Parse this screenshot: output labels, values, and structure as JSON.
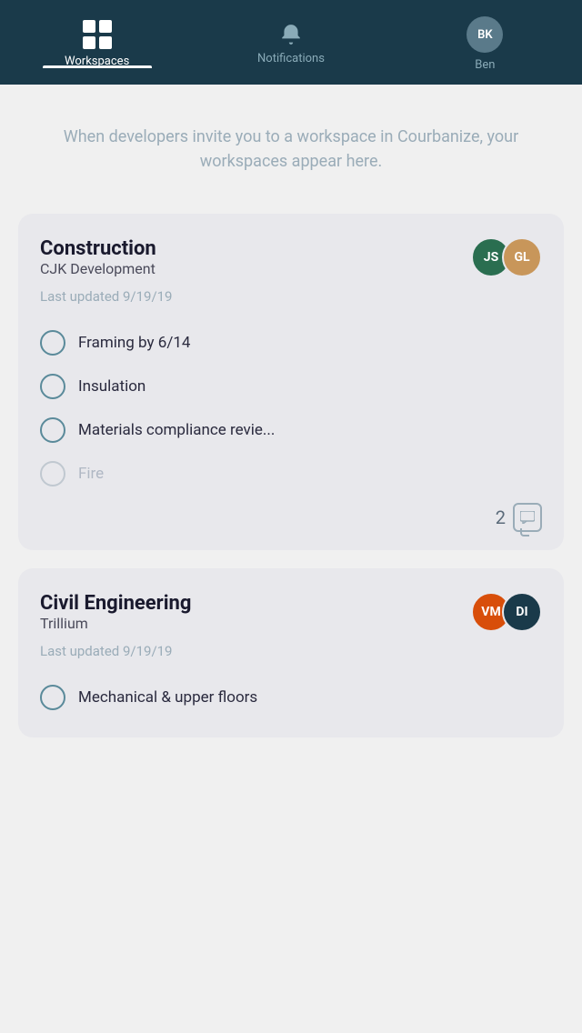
{
  "header": {
    "nav": [
      {
        "id": "workspaces",
        "label": "Workspaces",
        "active": true
      },
      {
        "id": "notifications",
        "label": "Notifications",
        "active": false
      },
      {
        "id": "profile",
        "label": "Ben",
        "initials": "BK",
        "active": false
      }
    ]
  },
  "info": {
    "text": "When developers invite you to a workspace in Courbanize, your workspaces appear here."
  },
  "cards": [
    {
      "id": "construction",
      "title": "Construction",
      "subtitle": "CJK Development",
      "last_updated": "Last updated 9/19/19",
      "avatars": [
        {
          "initials": "JS",
          "color": "#2a6e50"
        },
        {
          "initials": "GL",
          "color": "#c8965a"
        }
      ],
      "tasks": [
        {
          "label": "Framing by 6/14",
          "disabled": false
        },
        {
          "label": "Insulation",
          "disabled": false
        },
        {
          "label": "Materials compliance revie...",
          "disabled": false
        },
        {
          "label": "Fire",
          "disabled": true
        }
      ],
      "comment_count": "2"
    },
    {
      "id": "civil-engineering",
      "title": "Civil Engineering",
      "subtitle": "Trillium",
      "last_updated": "Last updated 9/19/19",
      "avatars": [
        {
          "initials": "VM",
          "color": "#d84e0a"
        },
        {
          "initials": "DI",
          "color": "#1a3a4a"
        }
      ],
      "tasks": [
        {
          "label": "Mechanical & upper floors",
          "disabled": false
        }
      ],
      "comment_count": ""
    }
  ]
}
